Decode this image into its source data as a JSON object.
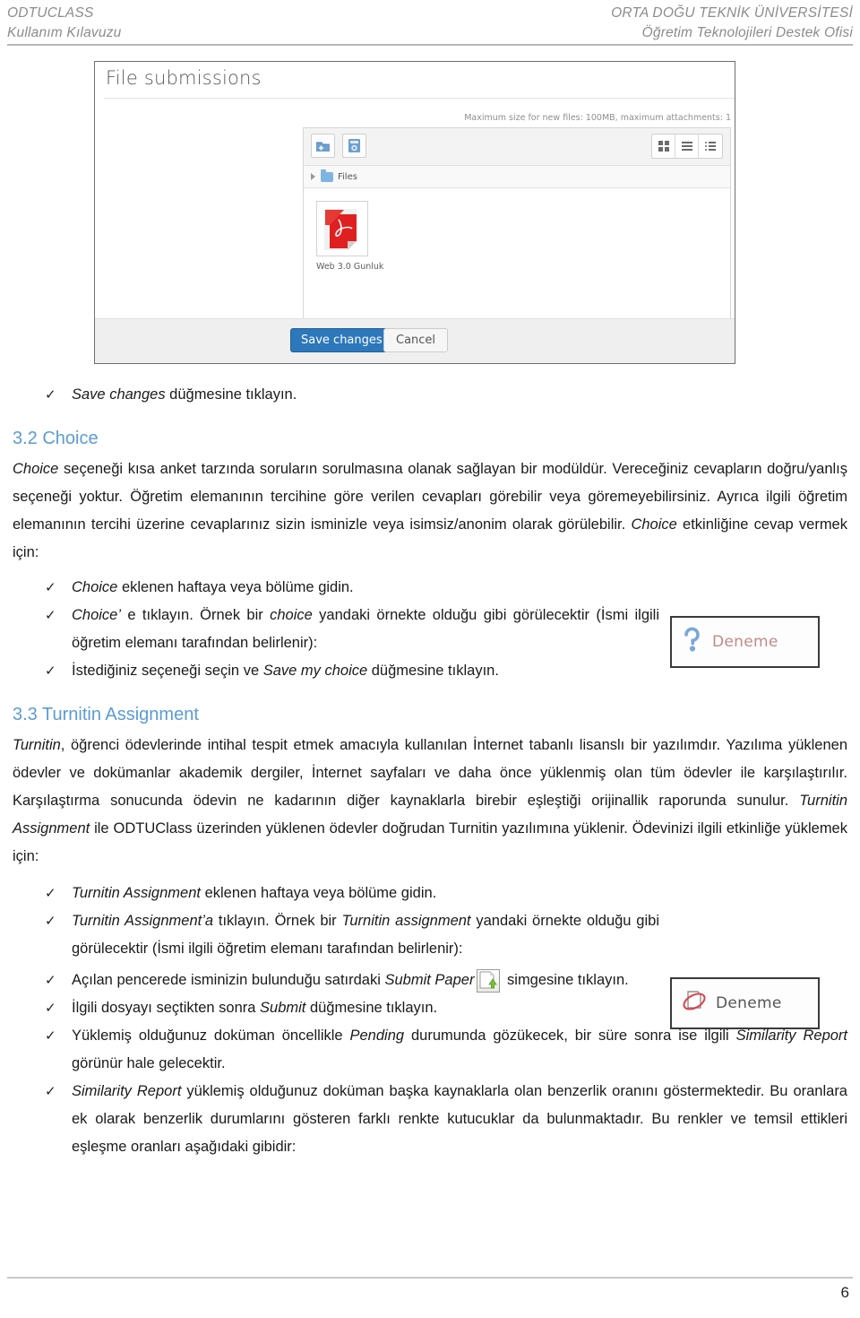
{
  "header": {
    "left_line1": "ODTUCLASS",
    "left_line2": "Kullanım Kılavuzu",
    "right_line1": "ORTA DOĞU TEKNİK ÜNİVERSİTESİ",
    "right_line2": "Öğretim Teknolojileri Destek Ofisi"
  },
  "screenshot": {
    "title": "File submissions",
    "max_size_note": "Maximum size for new files: 100MB, maximum attachments: 1",
    "breadcrumb_label": "Files",
    "file_name": "Web 3.0 Gunluk",
    "save_label": "Save changes",
    "cancel_label": "Cancel",
    "toolbar_icons": [
      "add-file-icon",
      "create-folder-icon"
    ],
    "view_icons": [
      "grid-view-icon",
      "list-view-icon",
      "tree-view-icon"
    ]
  },
  "bullet_save": {
    "tick": "✓",
    "italic": "Save changes",
    "rest": " düğmesine tıklayın."
  },
  "section_choice": {
    "heading": "3.2 Choice",
    "p1_a": "Choice",
    "p1_b": " seçeneği kısa anket tarzında soruların sorulmasına olanak sağlayan bir modüldür. Vereceğiniz cevapların doğru/yanlış seçeneği yoktur. Öğretim elemanının tercihine göre verilen cevapları görebilir veya göremeyebilirsiniz.  Ayrıca ilgili öğretim elemanının tercihi üzerine cevaplarınız sizin isminizle veya isimsiz/anonim olarak görülebilir. ",
    "p1_c": "Choice",
    "p1_d": " etkinliğine cevap vermek için:",
    "bullets": [
      {
        "tick": "✓",
        "i1": "Choice",
        "t1": " eklenen haftaya veya bölüme gidin."
      },
      {
        "tick": "✓",
        "i1": "Choice’",
        "t1": " e tıklayın. Örnek bir ",
        "i2": "choice",
        "t2": " yandaki örnekte olduğu gibi görülecektir (İsmi ilgili öğretim elemanı tarafından belirlenir):"
      },
      {
        "tick": "✓",
        "t1": "İstediğiniz seçeneği seçin ve ",
        "i2": "Save my choice",
        "t2": " düğmesine tıklayın."
      }
    ]
  },
  "example_choice": {
    "icon": "question-mark-icon",
    "label": "Deneme"
  },
  "example_turnitin": {
    "icon": "turnitin-paper-icon",
    "label": "Deneme"
  },
  "section_turnitin": {
    "heading": "3.3 Turnitin Assignment",
    "p1_a": "Turnitin",
    "p1_b": ", öğrenci ödevlerinde intihal tespit etmek amacıyla kullanılan İnternet tabanlı lisanslı bir yazılımdır. Yazılıma yüklenen ödevler ve dokümanlar akademik dergiler, İnternet sayfaları ve daha önce yüklenmiş olan tüm ödevler ile karşılaştırılır. Karşılaştırma sonucunda ödevin ne kadarının diğer kaynaklarla birebir eşleştiği orijinallik raporunda sunulur. ",
    "p1_c": "Turnitin Assignment",
    "p1_d": " ile ODTUClass üzerinden yüklenen ödevler doğrudan Turnitin yazılımına yüklenir. Ödevinizi ilgili etkinliğe yüklemek için:",
    "bullets": [
      {
        "tick": "✓",
        "i1": "Turnitin Assignment",
        "t1": " eklenen haftaya veya bölüme gidin."
      },
      {
        "tick": "✓",
        "i1": "Turnitin Assignment’a",
        "t1": " tıklayın. Örnek bir ",
        "i2": "Turnitin assignment",
        "t2": " yandaki örnekte olduğu gibi görülecektir (İsmi ilgili öğretim elemanı tarafından belirlenir):"
      }
    ],
    "bullets2": [
      {
        "tick": "✓",
        "t1": "Açılan pencerede isminizin bulunduğu satırdaki ",
        "i2": "Submit Paper",
        "icon": "submit-paper-icon",
        "t2": " simgesine tıklayın."
      },
      {
        "tick": "✓",
        "t1": "İlgili dosyayı seçtikten sonra ",
        "i2": "Submit",
        "t2": " düğmesine tıklayın."
      },
      {
        "tick": "✓",
        "t1": "Yüklemiş olduğunuz doküman öncellikle ",
        "i2": "Pending",
        "t2": " durumunda gözükecek, bir süre sonra ise ilgili ",
        "i3": "Similarity Report",
        "t3": " görünür hale gelecektir."
      },
      {
        "tick": "✓",
        "i1": "Similarity Report",
        "t1": " yüklemiş olduğunuz doküman başka kaynaklarla olan benzerlik oranını göstermektedir. Bu oranlara ek olarak benzerlik durumlarını gösteren farklı renkte kutucuklar da bulunmaktadır.  Bu renkler ve temsil ettikleri eşleşme oranları aşağıdaki gibidir:"
      }
    ]
  },
  "footer": {
    "page_number": "6"
  },
  "colors": {
    "heading_blue": "#5b9bd5",
    "header_gray": "#8c8c8c",
    "save_button_blue": "#2d77bb"
  }
}
